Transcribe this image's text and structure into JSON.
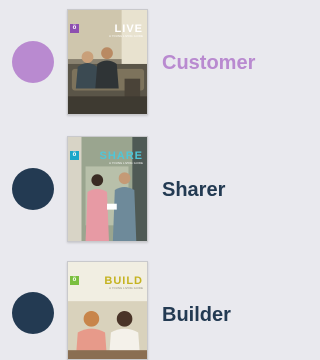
{
  "colors": {
    "background": "#e9e9ee",
    "accent_purple": "#b98ad0",
    "navy": "#233a52",
    "badge_live": "#8e4fb0",
    "badge_share": "#1aa7c9",
    "badge_build": "#7bbf3f",
    "title_share": "#4fc6d8",
    "title_build": "#c5b321",
    "title_live": "#ffffff"
  },
  "items": [
    {
      "id": "customer",
      "label": "Customer",
      "book_title": "LIVE",
      "book_subtitle": "A YOUNG LIVING GUIDE",
      "badge_glyph": "ö",
      "dot_color": "#b98ad0",
      "label_color": "#b98ad0"
    },
    {
      "id": "sharer",
      "label": "Sharer",
      "book_title": "SHARE",
      "book_subtitle": "A YOUNG LIVING GUIDE",
      "badge_glyph": "ö",
      "dot_color": "#233a52",
      "label_color": "#233a52"
    },
    {
      "id": "builder",
      "label": "Builder",
      "book_title": "BUILD",
      "book_subtitle": "A YOUNG LIVING GUIDE",
      "badge_glyph": "ö",
      "dot_color": "#233a52",
      "label_color": "#233a52"
    }
  ]
}
